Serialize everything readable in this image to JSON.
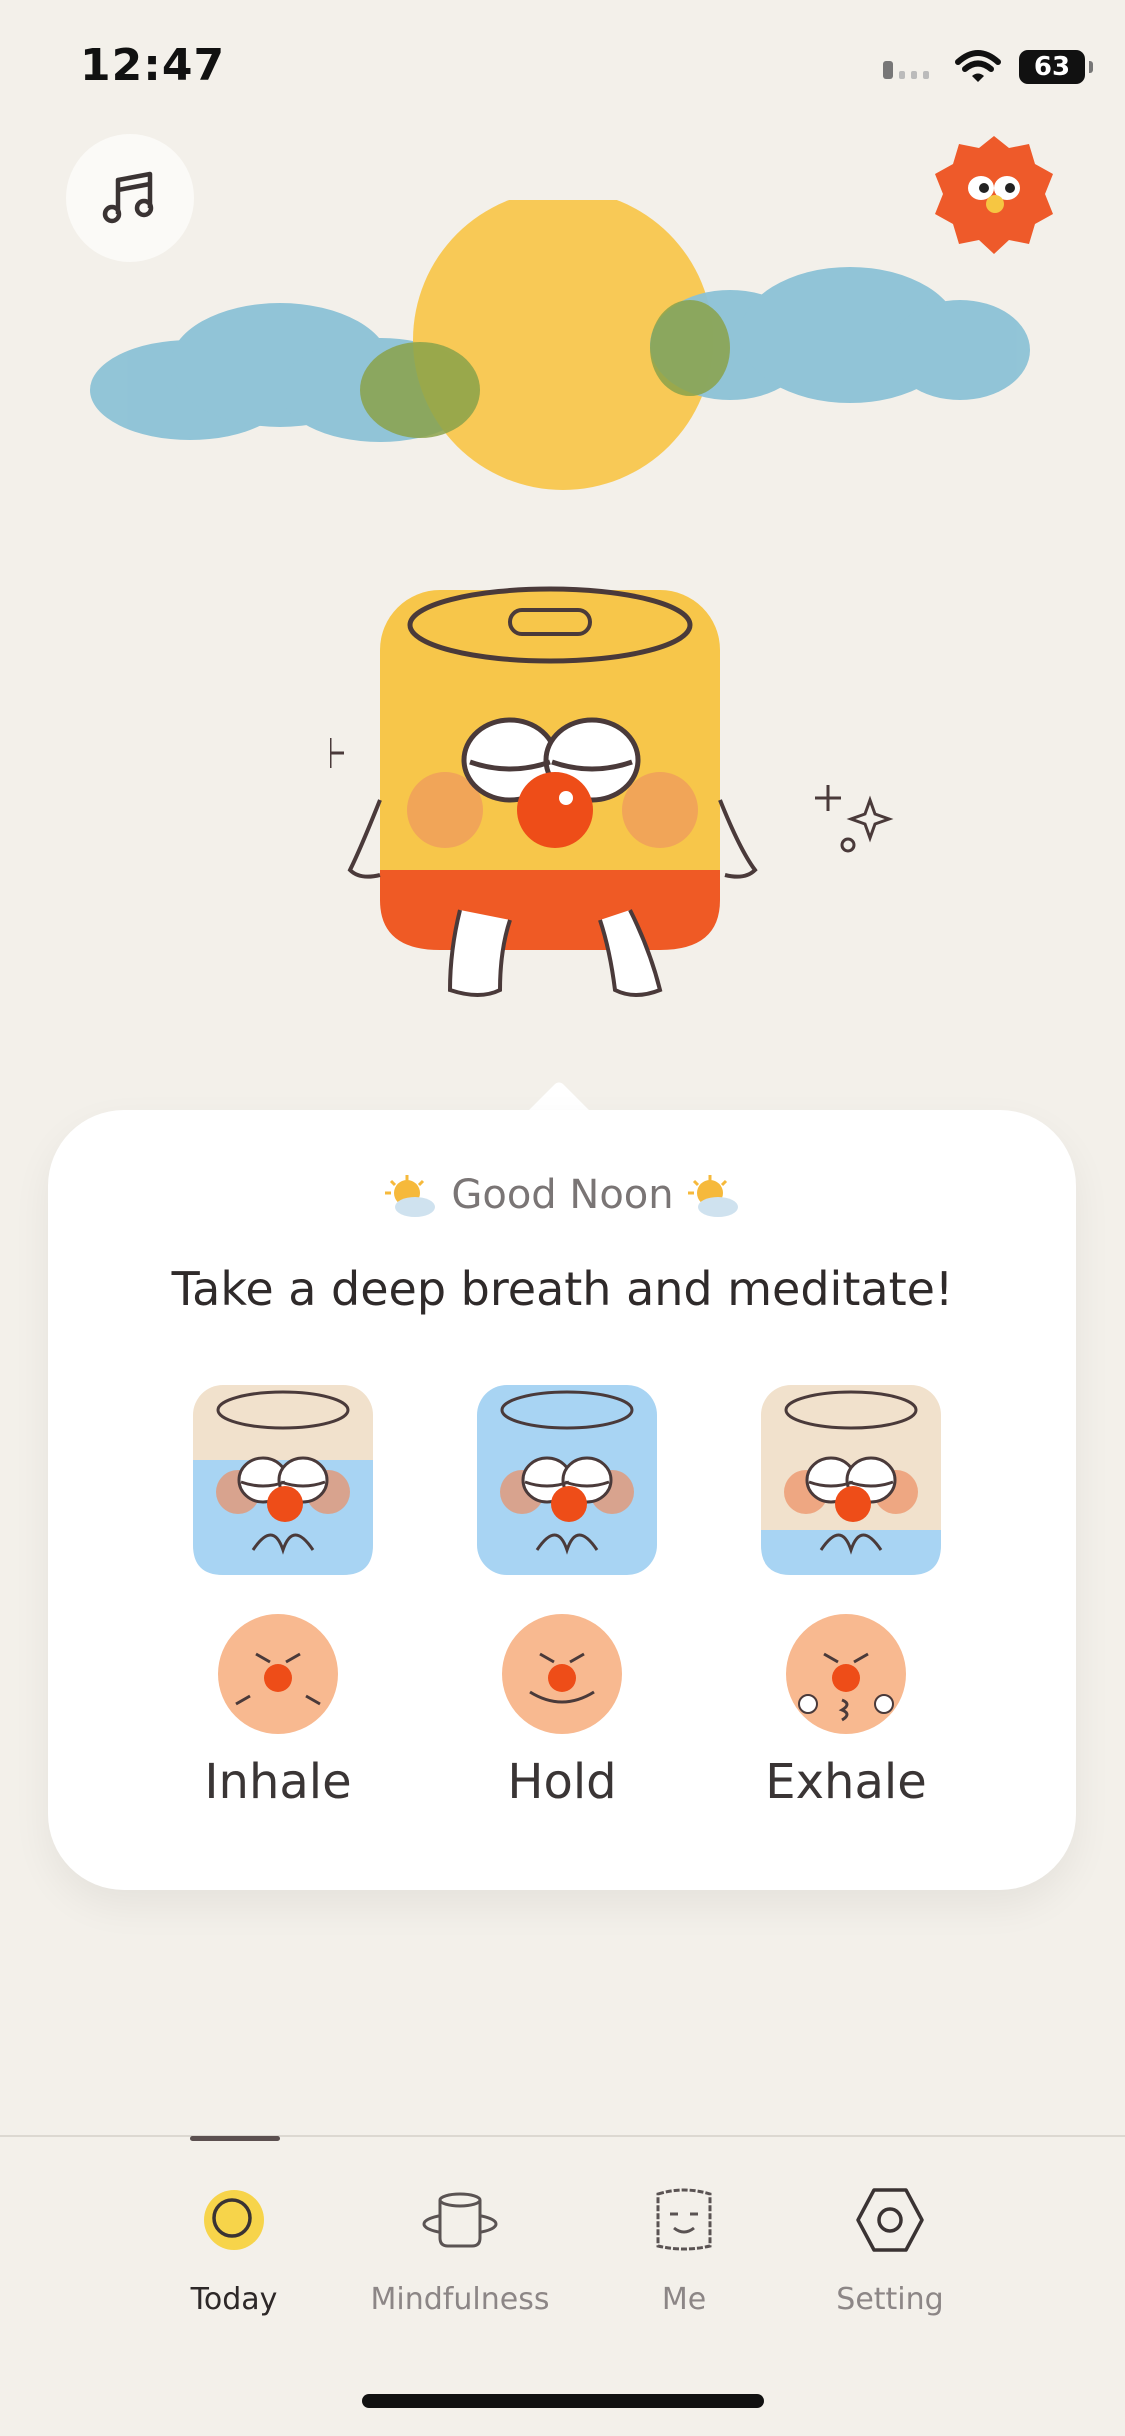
{
  "status_bar": {
    "time": "12:47",
    "battery": "63"
  },
  "greeting": {
    "text": "Good Noon"
  },
  "headline": "Take a deep breath and meditate!",
  "breathing_steps": [
    {
      "label": "Inhale"
    },
    {
      "label": "Hold"
    },
    {
      "label": "Exhale"
    }
  ],
  "tabs": [
    {
      "label": "Today",
      "icon": "sun-circle-icon",
      "active": true
    },
    {
      "label": "Mindfulness",
      "icon": "cup-icon",
      "active": false
    },
    {
      "label": "Me",
      "icon": "toast-face-icon",
      "active": false
    },
    {
      "label": "Setting",
      "icon": "hexagon-nut-icon",
      "active": false
    }
  ],
  "colors": {
    "background": "#f3f0ea",
    "sun": "#f7c64a",
    "cloud": "#8cc2d6",
    "accent_orange": "#f05a28",
    "card": "#ffffff"
  }
}
